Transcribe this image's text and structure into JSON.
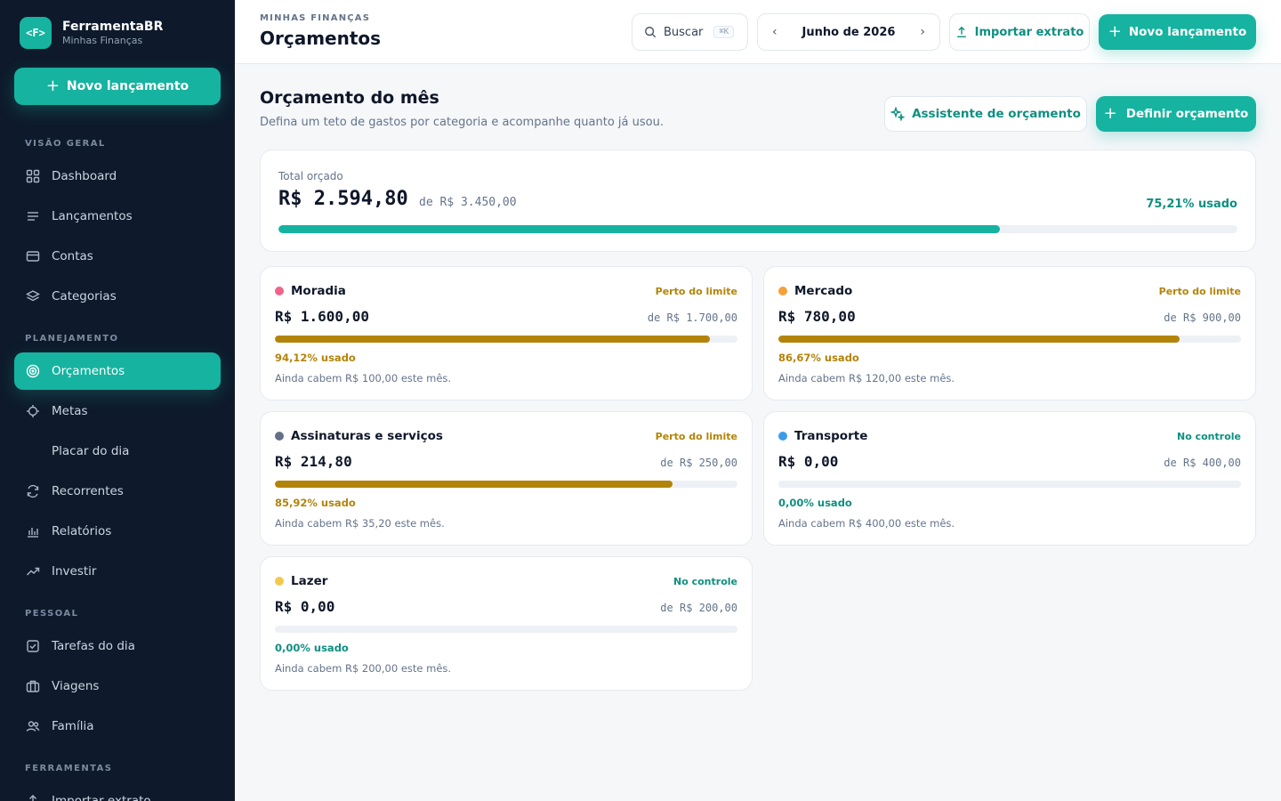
{
  "brand": {
    "logo": "<F>",
    "name": "FerramentaBR",
    "subtitle": "Minhas Finanças"
  },
  "sidebar": {
    "new_label": "Novo lançamento",
    "sections": [
      "VISÃO GERAL",
      "PLANEJAMENTO",
      "PESSOAL",
      "FERRAMENTAS"
    ],
    "items": [
      {
        "label": "Dashboard",
        "icon": "grid-icon"
      },
      {
        "label": "Lançamentos",
        "icon": "list-icon"
      },
      {
        "label": "Contas",
        "icon": "card-icon"
      },
      {
        "label": "Categorias",
        "icon": "layers-icon"
      },
      {
        "label": "Orçamentos",
        "icon": "target-icon",
        "active": true
      },
      {
        "label": "Metas",
        "icon": "crosshair-icon"
      },
      {
        "label": "Placar do dia",
        "icon": ""
      },
      {
        "label": "Recorrentes",
        "icon": "refresh-icon"
      },
      {
        "label": "Relatórios",
        "icon": "bar-chart-icon"
      },
      {
        "label": "Investir",
        "icon": "trending-up-icon"
      },
      {
        "label": "Tarefas do dia",
        "icon": "checkbox-icon"
      },
      {
        "label": "Viagens",
        "icon": "luggage-icon"
      },
      {
        "label": "Família",
        "icon": "users-icon"
      },
      {
        "label": "Importar extrato",
        "icon": "upload-icon"
      }
    ]
  },
  "header": {
    "breadcrumb": "MINHAS FINANÇAS",
    "title": "Orçamentos",
    "search_label": "Buscar",
    "search_shortcut": "⌘K",
    "month": "Junho de 2026",
    "prev": "‹",
    "next": "›",
    "import_label": "Importar extrato",
    "new_label": "Novo lançamento"
  },
  "main": {
    "title": "Orçamento do mês",
    "subtitle": "Defina um teto de gastos por categoria e acompanhe quanto já usou.",
    "assistant_label": "Assistente de orçamento",
    "define_label": "Definir orçamento",
    "total": {
      "label": "Total orçado",
      "amount": "R$ 2.594,80",
      "of": "de R$ 3.450,00",
      "pct_label": "75,21% usado",
      "pct": 75.21
    },
    "categories": [
      {
        "name": "Moradia",
        "color": "#f0648a",
        "status": "Perto do limite",
        "status_color": "#b3840a",
        "spent": "R$ 1.600,00",
        "budget": "de R$ 1.700,00",
        "pct": 94.12,
        "pct_label": "94,12% usado",
        "left": "Ainda cabem R$ 100,00 este mês."
      },
      {
        "name": "Mercado",
        "color": "#f5a13a",
        "status": "Perto do limite",
        "status_color": "#b3840a",
        "spent": "R$ 780,00",
        "budget": "de R$ 900,00",
        "pct": 86.67,
        "pct_label": "86,67% usado",
        "left": "Ainda cabem R$ 120,00 este mês."
      },
      {
        "name": "Assinaturas e serviços",
        "color": "#64708a",
        "status": "Perto do limite",
        "status_color": "#b3840a",
        "spent": "R$ 214,80",
        "budget": "de R$ 250,00",
        "pct": 85.92,
        "pct_label": "85,92% usado",
        "left": "Ainda cabem R$ 35,20 este mês."
      },
      {
        "name": "Transporte",
        "color": "#3b9be8",
        "status": "No controle",
        "status_color": "#0f8f80",
        "spent": "R$ 0,00",
        "budget": "de R$ 400,00",
        "pct": 0,
        "pct_label": "0,00% usado",
        "left": "Ainda cabem R$ 400,00 este mês."
      },
      {
        "name": "Lazer",
        "color": "#f2c94c",
        "status": "No controle",
        "status_color": "#0f8f80",
        "spent": "R$ 0,00",
        "budget": "de R$ 200,00",
        "pct": 0,
        "pct_label": "0,00% usado",
        "left": "Ainda cabem R$ 200,00 este mês."
      }
    ]
  },
  "colors": {
    "accent": "#16b3a0",
    "sidebar": "#0e1a2b",
    "warning": "#b3840a",
    "ok": "#0f8f80"
  }
}
